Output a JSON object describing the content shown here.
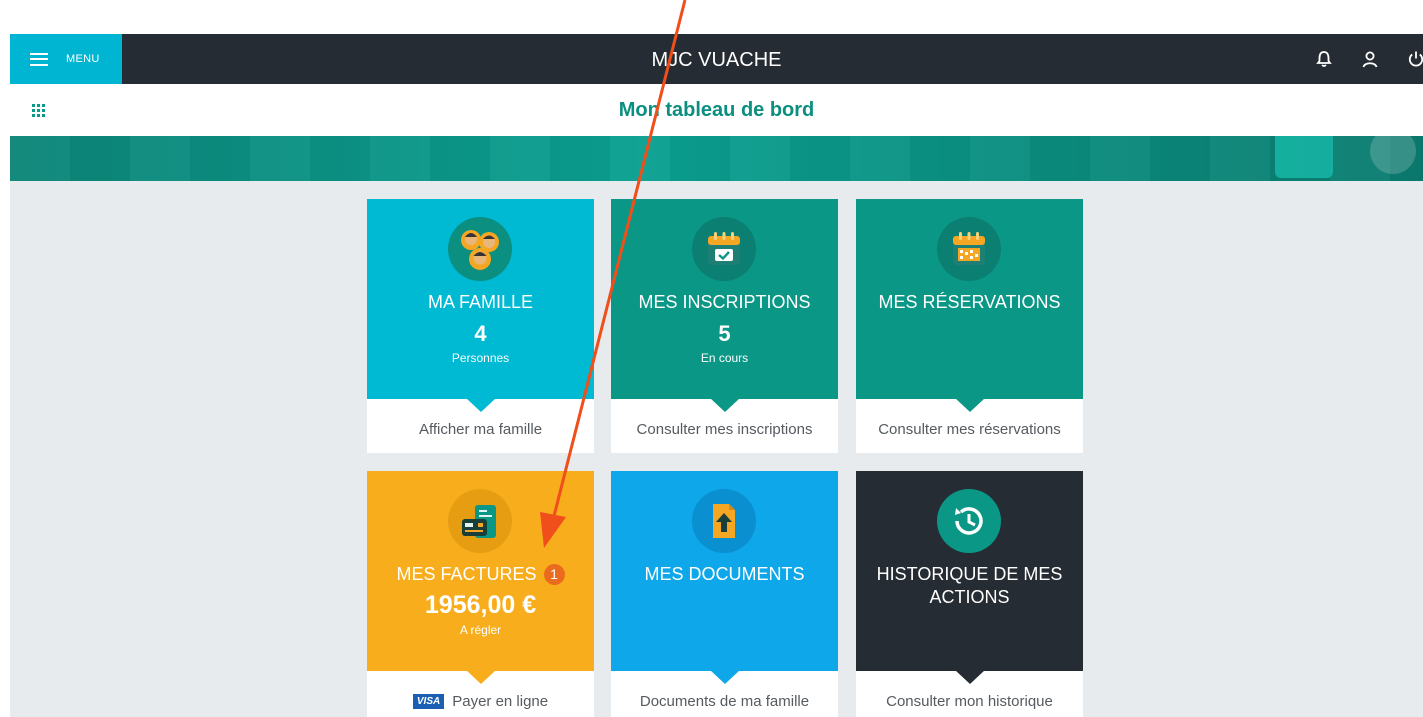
{
  "header": {
    "menu_label": "MENU",
    "app_title": "MJC VUACHE",
    "icons": [
      "bell-icon",
      "user-icon",
      "power-icon"
    ]
  },
  "subheader": {
    "title": "Mon tableau de bord",
    "apps_icon": "apps-grid-icon"
  },
  "tiles": {
    "famille": {
      "title": "MA FAMILLE",
      "count": "4",
      "sub": "Personnes",
      "link": "Afficher ma famille",
      "color": "#00b9d3",
      "icon": "family-icon"
    },
    "inscriptions": {
      "title": "MES INSCRIPTIONS",
      "count": "5",
      "sub": "En cours",
      "link": "Consulter mes inscriptions",
      "color": "#0a9786",
      "icon": "calendar-check-icon"
    },
    "reservations": {
      "title": "MES RÉSERVATIONS",
      "link": "Consulter mes réservations",
      "color": "#0a9786",
      "icon": "calendar-grid-icon"
    },
    "factures": {
      "title": "MES FACTURES",
      "badge": "1",
      "amount": "1956,00 €",
      "sub": "A régler",
      "link": "Payer en ligne",
      "visa": "VISA",
      "color": "#f8ae1c",
      "icon": "invoice-icon"
    },
    "documents": {
      "title": "MES DOCUMENTS",
      "link": "Documents de ma famille",
      "color": "#0ea7ea",
      "icon": "document-upload-icon"
    },
    "historique": {
      "title": "HISTORIQUE DE MES ACTIONS",
      "link": "Consulter mon historique",
      "color": "#262c33",
      "icon": "history-icon"
    }
  },
  "annotation": {
    "arrow_color": "#f04e1a"
  }
}
